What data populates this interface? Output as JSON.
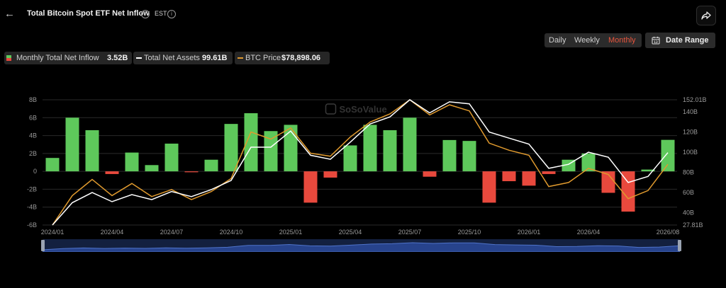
{
  "header": {
    "title": "Total Bitcoin Spot ETF Net Inflow",
    "timezone": "EST"
  },
  "period": {
    "options": [
      "Daily",
      "Weekly",
      "Monthly"
    ],
    "active": "Monthly"
  },
  "date_range_label": "Date Range",
  "legend": {
    "inflow_label": "Monthly Total Net Inflow",
    "inflow_value": "3.52B",
    "assets_label": "Total Net Assets",
    "assets_value": "99.61B",
    "price_label": "BTC Price",
    "price_value": "$78,898.06"
  },
  "watermark": "SoSoValue",
  "colors": {
    "positive": "#5ec85b",
    "negative": "#e8493d",
    "assets_line": "#ffffff",
    "price_line": "#e09a2e",
    "accent": "#e8553d"
  },
  "chart_data": {
    "type": "bar",
    "title": "Total Bitcoin Spot ETF Net Inflow",
    "x": [
      "2024/01",
      "2024/02",
      "2024/03",
      "2024/04",
      "2024/05",
      "2024/06",
      "2024/07",
      "2024/08",
      "2024/09",
      "2024/10",
      "2024/11",
      "2024/12",
      "2025/01",
      "2025/02",
      "2025/03",
      "2025/04",
      "2025/05",
      "2025/06",
      "2025/07",
      "2025/08",
      "2025/09",
      "2025/10",
      "2025/11",
      "2025/12",
      "2026/01",
      "2026/02",
      "2026/03",
      "2026/04",
      "2026/05",
      "2026/06",
      "2026/07",
      "2026/08"
    ],
    "x_ticks": [
      "2024/01",
      "2024/04",
      "2024/07",
      "2024/10",
      "2025/01",
      "2025/04",
      "2025/07",
      "2025/10",
      "2026/01",
      "2026/04",
      "2026/08"
    ],
    "series": [
      {
        "name": "Monthly Total Net Inflow",
        "axis": "left",
        "type": "bar",
        "values": [
          1.5,
          6.0,
          4.6,
          -0.3,
          2.1,
          0.7,
          3.1,
          -0.1,
          1.3,
          5.3,
          6.5,
          4.5,
          5.2,
          -3.5,
          -0.7,
          2.9,
          5.2,
          4.6,
          6.0,
          -0.6,
          3.5,
          3.4,
          -3.5,
          -1.1,
          -1.6,
          -0.3,
          1.3,
          2.0,
          -2.4,
          -4.5,
          0.2,
          3.52
        ]
      },
      {
        "name": "Total Net Assets",
        "axis": "right",
        "type": "line",
        "values": [
          27.81,
          50,
          60,
          51,
          58,
          53,
          61,
          56,
          63,
          72,
          105,
          105,
          121,
          97,
          93,
          110,
          128,
          135,
          152,
          139,
          150,
          148,
          120,
          114,
          108,
          84,
          88,
          100,
          95,
          70,
          76,
          99.61
        ]
      },
      {
        "name": "BTC Price",
        "axis": "right",
        "type": "line",
        "values": [
          27.81,
          57,
          73,
          57,
          69,
          56,
          63,
          53,
          61,
          74,
          120,
          113,
          124,
          99,
          96,
          115,
          130,
          138,
          152,
          137,
          147,
          141,
          109,
          102,
          97,
          66,
          70,
          84,
          78,
          54,
          62,
          88
        ]
      }
    ],
    "ylabel": "",
    "ylim_left": [
      -6,
      8
    ],
    "yticks_left": [
      "-6B",
      "-4B",
      "-2B",
      "0",
      "2B",
      "4B",
      "6B",
      "8B"
    ],
    "ylim_right": [
      27.81,
      152.01
    ],
    "yticks_right": [
      "27.81B",
      "40B",
      "60B",
      "80B",
      "100B",
      "120B",
      "140B",
      "152.01B"
    ],
    "grid": true,
    "legend": "top-left"
  }
}
